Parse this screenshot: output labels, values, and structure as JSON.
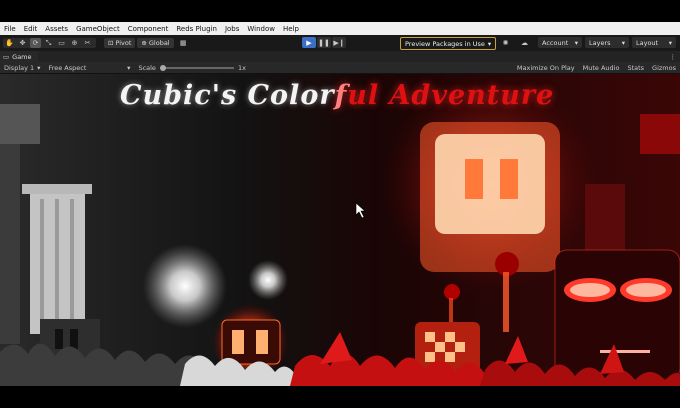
{
  "menu": [
    "File",
    "Edit",
    "Assets",
    "GameObject",
    "Component",
    "Reds Plugin",
    "Jobs",
    "Window",
    "Help"
  ],
  "toolbar": {
    "pivot_label": "Pivot",
    "global_label": "Global",
    "preview_packages": "Preview Packages in Use",
    "account_label": "Account",
    "layers_label": "Layers",
    "layout_label": "Layout"
  },
  "tab": {
    "game_label": "Game"
  },
  "gamebar": {
    "display": "Display 1",
    "aspect": "Free Aspect",
    "scale_label": "Scale",
    "scale_value": "1x",
    "maximize": "Maximize On Play",
    "mute": "Mute Audio",
    "stats": "Stats",
    "gizmos": "Gizmos"
  },
  "game": {
    "title_white": "Cubic's Color",
    "title_split": "f",
    "title_red": "ul Adventure"
  },
  "colors": {
    "accent_play": "#3a6fc5",
    "title_red": "#e01010",
    "preview_border": "#c8a33a"
  }
}
